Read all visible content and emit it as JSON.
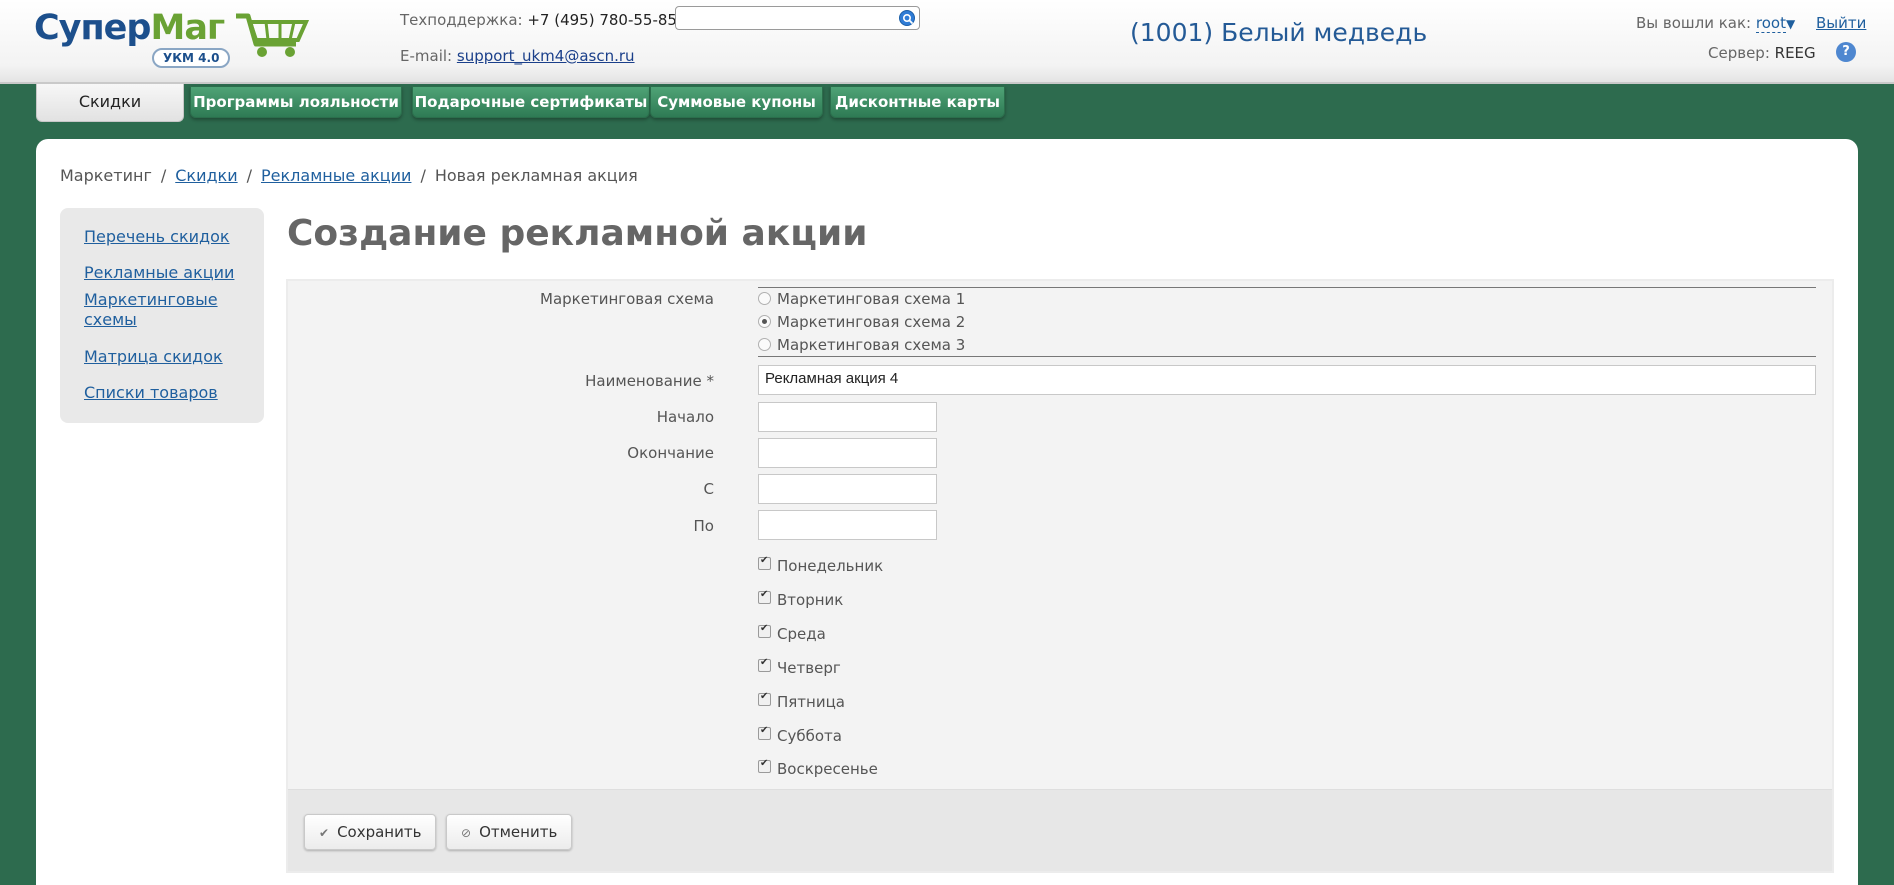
{
  "header": {
    "logo_part1": "Супер",
    "logo_part2": "Маг",
    "logo_badge": "УКМ 4.0",
    "support_label": "Техподдержка:",
    "support_phone": "+7 (495) 780-55-85",
    "email_label": "E-mail:",
    "email": "support_ukm4@ascn.ru",
    "search_value": "",
    "store_name": "(1001) Белый медведь",
    "logged_in_label": "Вы вошли как:",
    "username": "root",
    "logout": "Выйти",
    "server_label": "Сервер:",
    "server_value": "REEG",
    "help_glyph": "?"
  },
  "tabs": [
    {
      "label": "Скидки",
      "active": true
    },
    {
      "label": "Программы лояльности"
    },
    {
      "label": "Подарочные сертификаты"
    },
    {
      "label": "Суммовые купоны"
    },
    {
      "label": "Дисконтные карты"
    }
  ],
  "breadcrumb": {
    "root": "Маркетинг",
    "link1": "Скидки",
    "link2": "Рекламные акции",
    "current": "Новая рекламная акция",
    "separator": "/"
  },
  "sidebar": {
    "items": [
      {
        "label": "Перечень скидок"
      },
      {
        "label": "Рекламные акции"
      },
      {
        "label": "Маркетинговые схемы"
      },
      {
        "label": "Матрица скидок"
      },
      {
        "label": "Списки товаров"
      }
    ]
  },
  "page_title": "Создание рекламной акции",
  "form": {
    "scheme_label": "Маркетинговая схема",
    "scheme_options": [
      {
        "label": "Маркетинговая схема 1",
        "selected": false
      },
      {
        "label": "Маркетинговая схема 2",
        "selected": true
      },
      {
        "label": "Маркетинговая схема 3",
        "selected": false
      }
    ],
    "name_label": "Наименование *",
    "name_value": "Рекламная акция 4",
    "start_label": "Начало",
    "end_label": "Окончание",
    "from_label": "С",
    "to_label": "По",
    "days": [
      {
        "label": "Понедельник",
        "checked": true
      },
      {
        "label": "Вторник",
        "checked": true
      },
      {
        "label": "Среда",
        "checked": true
      },
      {
        "label": "Четверг",
        "checked": true
      },
      {
        "label": "Пятница",
        "checked": true
      },
      {
        "label": "Суббота",
        "checked": true
      },
      {
        "label": "Воскресенье",
        "checked": true
      }
    ],
    "save_label": "Сохранить",
    "cancel_label": "Отменить"
  },
  "colors": {
    "background": "#2d6b4e",
    "tab_green": "#3d8f63",
    "link": "#1f5f9e",
    "store_name": "#245a96"
  }
}
